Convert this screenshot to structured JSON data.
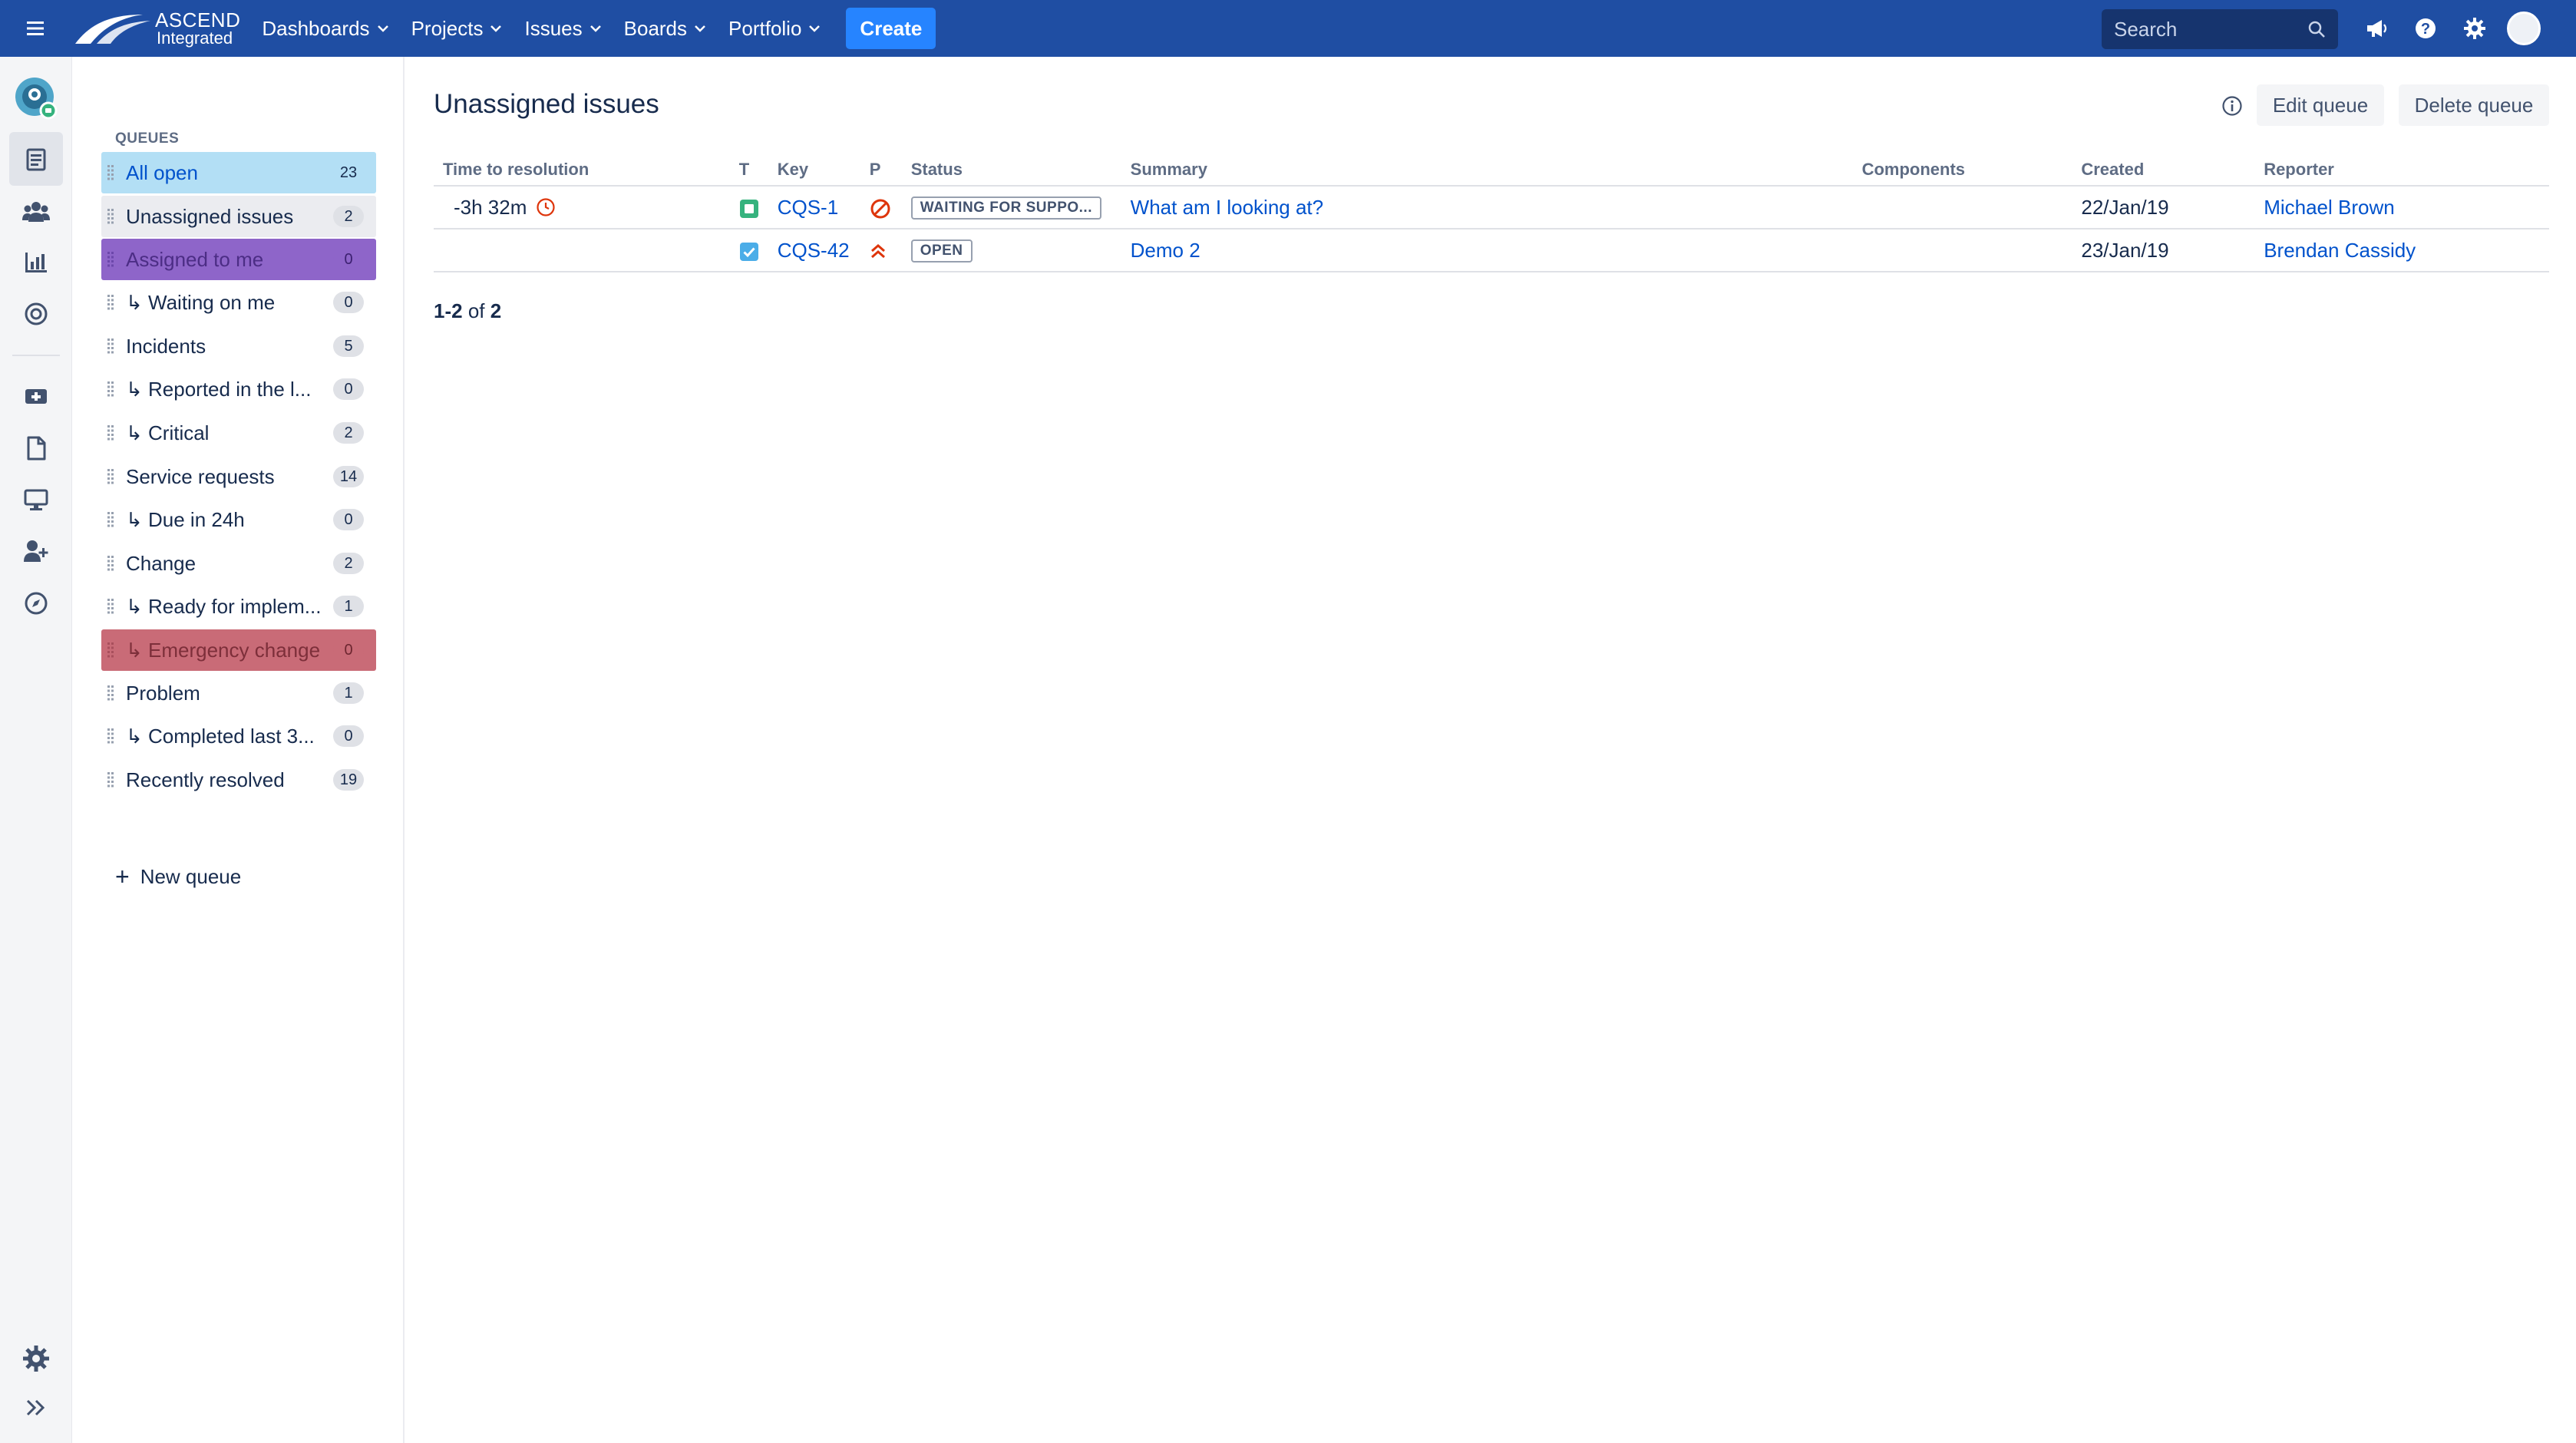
{
  "nav": {
    "logo_line1": "ASCEND",
    "logo_line2": "Integrated",
    "menu": [
      {
        "label": "Dashboards"
      },
      {
        "label": "Projects"
      },
      {
        "label": "Issues"
      },
      {
        "label": "Boards"
      },
      {
        "label": "Portfolio"
      }
    ],
    "create_label": "Create",
    "search_placeholder": "Search",
    "icons": [
      "megaphone-icon",
      "help-icon",
      "settings-gear-icon",
      "user-avatar"
    ]
  },
  "left_sidebar": {
    "icons": [
      "project-avatar",
      "queues-icon",
      "customers-icon",
      "reports-icon",
      "channels-icon",
      "raise-request-icon",
      "knowledge-base-icon",
      "assets-icon",
      "invite-team-icon",
      "compass-icon",
      "project-settings-icon",
      "expand-sidebar-icon"
    ]
  },
  "queues": {
    "title": "QUEUES",
    "items": [
      {
        "label": "All open",
        "count": "23",
        "sub": false
      },
      {
        "label": "Unassigned issues",
        "count": "2",
        "sub": false
      },
      {
        "label": "Assigned to me",
        "count": "0",
        "sub": false
      },
      {
        "label": "↳ Waiting on me",
        "count": "0",
        "sub": true
      },
      {
        "label": "Incidents",
        "count": "5",
        "sub": false
      },
      {
        "label": "↳ Reported in the l...",
        "count": "0",
        "sub": true
      },
      {
        "label": "↳ Critical",
        "count": "2",
        "sub": true
      },
      {
        "label": "Service requests",
        "count": "14",
        "sub": false
      },
      {
        "label": "↳ Due in 24h",
        "count": "0",
        "sub": true
      },
      {
        "label": "Change",
        "count": "2",
        "sub": false
      },
      {
        "label": "↳ Ready for implem...",
        "count": "1",
        "sub": true
      },
      {
        "label": "↳ Emergency change",
        "count": "0",
        "sub": true
      },
      {
        "label": "Problem",
        "count": "1",
        "sub": false
      },
      {
        "label": "↳ Completed last 3...",
        "count": "0",
        "sub": true
      },
      {
        "label": "Recently resolved",
        "count": "19",
        "sub": false
      }
    ],
    "new_queue_label": "New queue"
  },
  "main": {
    "title": "Unassigned issues",
    "edit_queue_label": "Edit queue",
    "delete_queue_label": "Delete queue",
    "columns": [
      "Time to resolution",
      "T",
      "Key",
      "P",
      "Status",
      "Summary",
      "Components",
      "Created",
      "Reporter"
    ],
    "rows": [
      {
        "time_to_resolution": "-3h 32m",
        "type_icon": "service-request-icon",
        "key": "CQS-1",
        "priority_icon": "blocker-priority-icon",
        "status": "WAITING FOR SUPPO...",
        "summary": "What am I looking at?",
        "components": "",
        "created": "22/Jan/19",
        "reporter": "Michael Brown"
      },
      {
        "time_to_resolution": "",
        "type_icon": "task-icon",
        "key": "CQS-42",
        "priority_icon": "highest-priority-icon",
        "status": "OPEN",
        "summary": "Demo 2",
        "components": "",
        "created": "23/Jan/19",
        "reporter": "Brendan Cassidy"
      }
    ],
    "pager": {
      "from": "1",
      "to": "2",
      "of_word": "of",
      "total": "2"
    }
  },
  "colors": {
    "topnav": "#1f4ea3",
    "create_button": "#2684ff",
    "link": "#0052cc",
    "queue_all_open": "#b3dff5",
    "queue_assigned_to_me": "#8e65c9",
    "queue_emergency_change": "#c96b77"
  }
}
